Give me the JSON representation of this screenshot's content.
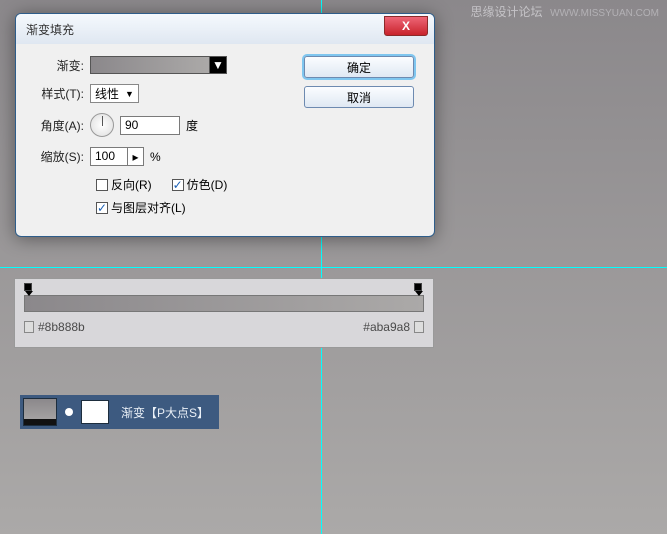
{
  "watermark": {
    "text": "思缘设计论坛",
    "url": "WWW.MISSYUAN.COM"
  },
  "dialog": {
    "title": "渐变填充",
    "gradient_label": "渐变:",
    "style_label": "样式(T):",
    "style_value": "线性",
    "angle_label": "角度(A):",
    "angle_value": "90",
    "angle_unit": "度",
    "scale_label": "缩放(S):",
    "scale_value": "100",
    "scale_unit": "%",
    "reverse_label": "反向(R)",
    "dither_label": "仿色(D)",
    "align_label": "与图层对齐(L)",
    "ok": "确定",
    "cancel": "取消"
  },
  "editor": {
    "hex_left": "#8b888b",
    "hex_right": "#aba9a8"
  },
  "layer": {
    "name": "渐变【P大点S】"
  },
  "glyphs": {
    "close": "X",
    "down": "▼",
    "right": "▸",
    "check": "✓"
  }
}
